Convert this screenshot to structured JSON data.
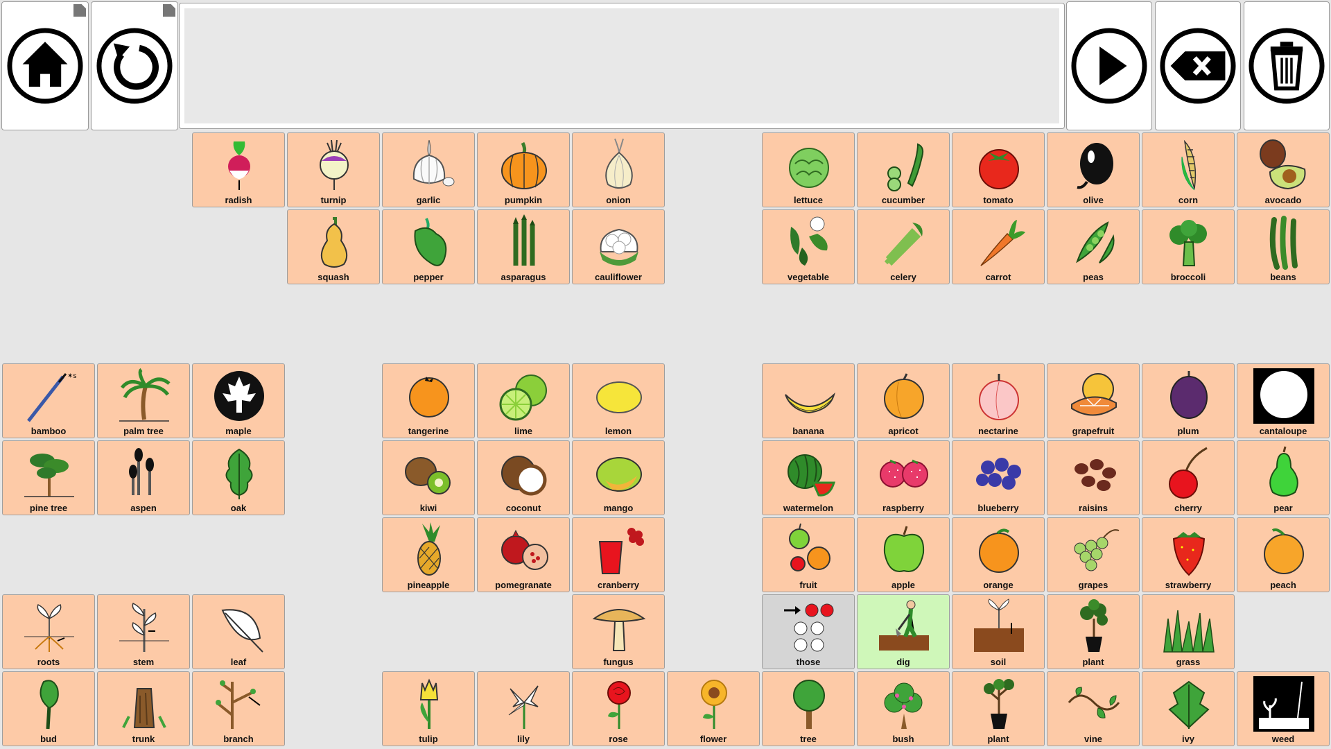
{
  "toolbar": {
    "home_icon": "home-icon",
    "back_icon": "undo-icon",
    "message_text": "",
    "speak_icon": "play-icon",
    "backspace_icon": "backspace-icon",
    "clear_icon": "trash-icon"
  },
  "tiles": [
    {
      "label": "radish",
      "icon": "radish-icon",
      "col": 2,
      "row": 0
    },
    {
      "label": "turnip",
      "icon": "turnip-icon",
      "col": 3,
      "row": 0
    },
    {
      "label": "garlic",
      "icon": "garlic-icon",
      "col": 4,
      "row": 0
    },
    {
      "label": "pumpkin",
      "icon": "pumpkin-icon",
      "col": 5,
      "row": 0
    },
    {
      "label": "onion",
      "icon": "onion-icon",
      "col": 6,
      "row": 0
    },
    {
      "label": "lettuce",
      "icon": "lettuce-icon",
      "col": 8,
      "row": 0
    },
    {
      "label": "cucumber",
      "icon": "cucumber-icon",
      "col": 9,
      "row": 0
    },
    {
      "label": "tomato",
      "icon": "tomato-icon",
      "col": 10,
      "row": 0
    },
    {
      "label": "olive",
      "icon": "olive-icon",
      "col": 11,
      "row": 0
    },
    {
      "label": "corn",
      "icon": "corn-icon",
      "col": 12,
      "row": 0
    },
    {
      "label": "avocado",
      "icon": "avocado-icon",
      "col": 13,
      "row": 0
    },
    {
      "label": "squash",
      "icon": "squash-icon",
      "col": 3,
      "row": 1
    },
    {
      "label": "pepper",
      "icon": "pepper-icon",
      "col": 4,
      "row": 1
    },
    {
      "label": "asparagus",
      "icon": "asparagus-icon",
      "col": 5,
      "row": 1
    },
    {
      "label": "cauliflower",
      "icon": "cauliflower-icon",
      "col": 6,
      "row": 1
    },
    {
      "label": "vegetable",
      "icon": "vegetable-icon",
      "col": 8,
      "row": 1
    },
    {
      "label": "celery",
      "icon": "celery-icon",
      "col": 9,
      "row": 1
    },
    {
      "label": "carrot",
      "icon": "carrot-icon",
      "col": 10,
      "row": 1
    },
    {
      "label": "peas",
      "icon": "peas-icon",
      "col": 11,
      "row": 1
    },
    {
      "label": "broccoli",
      "icon": "broccoli-icon",
      "col": 12,
      "row": 1
    },
    {
      "label": "beans",
      "icon": "beans-icon",
      "col": 13,
      "row": 1
    },
    {
      "label": "bamboo",
      "icon": "bamboo-icon",
      "col": 0,
      "row": 3
    },
    {
      "label": "palm tree",
      "icon": "palm-tree-icon",
      "col": 1,
      "row": 3
    },
    {
      "label": "maple",
      "icon": "maple-icon",
      "col": 2,
      "row": 3
    },
    {
      "label": "tangerine",
      "icon": "tangerine-icon",
      "col": 4,
      "row": 3
    },
    {
      "label": "lime",
      "icon": "lime-icon",
      "col": 5,
      "row": 3
    },
    {
      "label": "lemon",
      "icon": "lemon-icon",
      "col": 6,
      "row": 3
    },
    {
      "label": "banana",
      "icon": "banana-icon",
      "col": 8,
      "row": 3
    },
    {
      "label": "apricot",
      "icon": "apricot-icon",
      "col": 9,
      "row": 3
    },
    {
      "label": "nectarine",
      "icon": "nectarine-icon",
      "col": 10,
      "row": 3
    },
    {
      "label": "grapefruit",
      "icon": "grapefruit-icon",
      "col": 11,
      "row": 3
    },
    {
      "label": "plum",
      "icon": "plum-icon",
      "col": 12,
      "row": 3
    },
    {
      "label": "cantaloupe",
      "icon": "cantaloupe-icon",
      "col": 13,
      "row": 3
    },
    {
      "label": "pine tree",
      "icon": "pine-tree-icon",
      "col": 0,
      "row": 4
    },
    {
      "label": "aspen",
      "icon": "aspen-icon",
      "col": 1,
      "row": 4
    },
    {
      "label": "oak",
      "icon": "oak-icon",
      "col": 2,
      "row": 4
    },
    {
      "label": "kiwi",
      "icon": "kiwi-icon",
      "col": 4,
      "row": 4
    },
    {
      "label": "coconut",
      "icon": "coconut-icon",
      "col": 5,
      "row": 4
    },
    {
      "label": "mango",
      "icon": "mango-icon",
      "col": 6,
      "row": 4
    },
    {
      "label": "watermelon",
      "icon": "watermelon-icon",
      "col": 8,
      "row": 4
    },
    {
      "label": "raspberry",
      "icon": "raspberry-icon",
      "col": 9,
      "row": 4
    },
    {
      "label": "blueberry",
      "icon": "blueberry-icon",
      "col": 10,
      "row": 4
    },
    {
      "label": "raisins",
      "icon": "raisins-icon",
      "col": 11,
      "row": 4
    },
    {
      "label": "cherry",
      "icon": "cherry-icon",
      "col": 12,
      "row": 4
    },
    {
      "label": "pear",
      "icon": "pear-icon",
      "col": 13,
      "row": 4
    },
    {
      "label": "pineapple",
      "icon": "pineapple-icon",
      "col": 4,
      "row": 5
    },
    {
      "label": "pomegranate",
      "icon": "pomegranate-icon",
      "col": 5,
      "row": 5
    },
    {
      "label": "cranberry",
      "icon": "cranberry-icon",
      "col": 6,
      "row": 5
    },
    {
      "label": "fruit",
      "icon": "fruit-icon",
      "col": 8,
      "row": 5
    },
    {
      "label": "apple",
      "icon": "apple-icon",
      "col": 9,
      "row": 5
    },
    {
      "label": "orange",
      "icon": "orange-icon",
      "col": 10,
      "row": 5
    },
    {
      "label": "grapes",
      "icon": "grapes-icon",
      "col": 11,
      "row": 5
    },
    {
      "label": "strawberry",
      "icon": "strawberry-icon",
      "col": 12,
      "row": 5
    },
    {
      "label": "peach",
      "icon": "peach-icon",
      "col": 13,
      "row": 5
    },
    {
      "label": "roots",
      "icon": "roots-icon",
      "col": 0,
      "row": 6
    },
    {
      "label": "stem",
      "icon": "stem-icon",
      "col": 1,
      "row": 6
    },
    {
      "label": "leaf",
      "icon": "leaf-icon",
      "col": 2,
      "row": 6
    },
    {
      "label": "fungus",
      "icon": "fungus-icon",
      "col": 6,
      "row": 6
    },
    {
      "label": "those",
      "icon": "those-icon",
      "col": 8,
      "row": 6,
      "bg": "#d5d5d5"
    },
    {
      "label": "dig",
      "icon": "dig-icon",
      "col": 9,
      "row": 6,
      "bg": "#cff7b9"
    },
    {
      "label": "soil",
      "icon": "soil-icon",
      "col": 10,
      "row": 6
    },
    {
      "label": "plant",
      "icon": "potted-plant-icon",
      "col": 11,
      "row": 6
    },
    {
      "label": "grass",
      "icon": "grass-icon",
      "col": 12,
      "row": 6
    },
    {
      "label": "bud",
      "icon": "bud-icon",
      "col": 0,
      "row": 7
    },
    {
      "label": "trunk",
      "icon": "trunk-icon",
      "col": 1,
      "row": 7
    },
    {
      "label": "branch",
      "icon": "branch-icon",
      "col": 2,
      "row": 7
    },
    {
      "label": "tulip",
      "icon": "tulip-icon",
      "col": 4,
      "row": 7
    },
    {
      "label": "lily",
      "icon": "lily-icon",
      "col": 5,
      "row": 7
    },
    {
      "label": "rose",
      "icon": "rose-icon",
      "col": 6,
      "row": 7
    },
    {
      "label": "flower",
      "icon": "flower-icon",
      "col": 7,
      "row": 7
    },
    {
      "label": "tree",
      "icon": "tree-icon",
      "col": 8,
      "row": 7
    },
    {
      "label": "bush",
      "icon": "bush-icon",
      "col": 9,
      "row": 7
    },
    {
      "label": "plant",
      "icon": "plant-icon",
      "col": 10,
      "row": 7
    },
    {
      "label": "vine",
      "icon": "vine-icon",
      "col": 11,
      "row": 7
    },
    {
      "label": "ivy",
      "icon": "ivy-icon",
      "col": 12,
      "row": 7
    },
    {
      "label": "weed",
      "icon": "weed-icon",
      "col": 13,
      "row": 7
    }
  ]
}
